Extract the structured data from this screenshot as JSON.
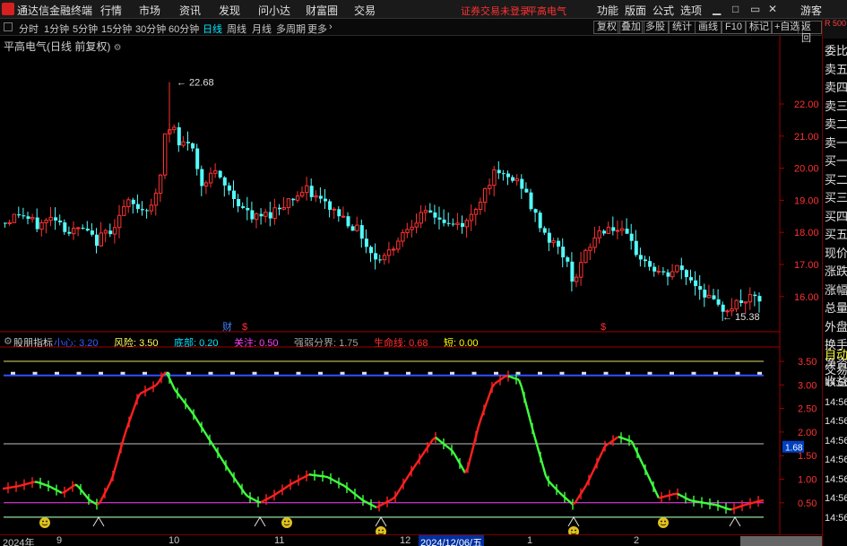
{
  "menubar": {
    "app_name": "通达信金融终端",
    "menus": [
      "行情",
      "市场",
      "资讯",
      "发现",
      "问小达",
      "财富圈",
      "交易"
    ],
    "warning": "证券交易未登录",
    "stock_name": "平高电气",
    "tools": [
      "功能",
      "版面",
      "公式",
      "选项"
    ],
    "user": "游客"
  },
  "periodbar": {
    "periods": [
      "分时",
      "1分钟",
      "5分钟",
      "15分钟",
      "30分钟",
      "60分钟",
      "日线",
      "周线",
      "月线",
      "多周期",
      "更多"
    ],
    "active_period": "日线",
    "right_buttons": [
      "复权",
      "叠加",
      "多股",
      "统计",
      "画线",
      "F10",
      "标记",
      "+自选",
      "返回"
    ]
  },
  "main_chart": {
    "title": "平高电气(日线 前复权)",
    "y_ticks": [
      "22.00",
      "21.00",
      "20.00",
      "19.00",
      "18.00",
      "17.00",
      "16.00"
    ],
    "high_label": "22.68",
    "low_label": "15.38",
    "marker_cai": "财",
    "marker_dollar": "$"
  },
  "indicator": {
    "name": "股朋指标",
    "params": [
      {
        "label": "小心:",
        "value": "3.20",
        "color": "#3060ff"
      },
      {
        "label": "风险:",
        "value": "3.50",
        "color": "#ffff60"
      },
      {
        "label": "底部:",
        "value": "0.20",
        "color": "#00e5ff"
      },
      {
        "label": "关注:",
        "value": "0.50",
        "color": "#ff40ff"
      },
      {
        "label": "强弱分界:",
        "value": "1.75",
        "color": "#a0a0a0"
      },
      {
        "label": "生命线:",
        "value": "0.68",
        "color": "#ff3030"
      },
      {
        "label": "短:",
        "value": "0.00",
        "color": "#ffff00"
      }
    ],
    "y_ticks": [
      "3.50",
      "3.00",
      "2.50",
      "2.00",
      "1.50",
      "1.00",
      "0.50"
    ],
    "current_value": "1.68"
  },
  "right_panel": {
    "top_label": "R 500",
    "items": [
      "委比",
      "卖五",
      "卖四",
      "卖三",
      "卖二",
      "卖一",
      "买一",
      "买二",
      "买三",
      "买四",
      "买五",
      "现价",
      "涨跌",
      "涨幅",
      "总量",
      "外盘",
      "换手",
      "净资",
      "收益",
      "自动",
      "交易",
      "14:56",
      "14:56",
      "14:56",
      "14:56",
      "14:56",
      "14:56",
      "14:56",
      "14:56"
    ]
  },
  "date_axis": {
    "labels": [
      "2024年",
      "9",
      "10",
      "11",
      "12",
      "2024/12/06/五",
      "1",
      "2"
    ]
  },
  "colors": {
    "up": "#ff3232",
    "down": "#54fcfc",
    "indicator_up": "#ff2020",
    "indicator_down": "#40ff40"
  }
}
